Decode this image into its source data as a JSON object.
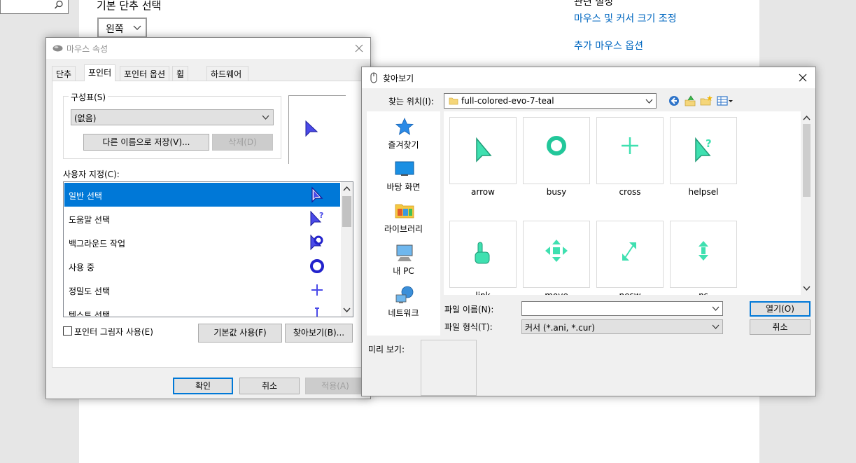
{
  "background": {
    "heading": "기본 단추 선택",
    "button_select_value": "왼쪽",
    "related_heading": "관련 설정",
    "links": [
      "마우스 및 커서 크기 조정",
      "추가 마우스 옵션"
    ]
  },
  "mouse_props": {
    "title": "마우스 속성",
    "tabs": [
      "단추",
      "포인터",
      "포인터 옵션",
      "휠",
      "하드웨어"
    ],
    "active_tab": "포인터",
    "scheme_label": "구성표(S)",
    "scheme_value": "(없음)",
    "save_as_label": "다른 이름으로 저장(V)...",
    "delete_label": "삭제(D)",
    "custom_label": "사용자 지정(C):",
    "cursor_items": [
      "일반 선택",
      "도움말 선택",
      "백그라운드 작업",
      "사용 중",
      "정밀도 선택",
      "텍스트 선택"
    ],
    "selected_index": 0,
    "shadow_label": "포인터 그림자 사용(E)",
    "default_label": "기본값 사용(F)",
    "browse_label": "찾아보기(B)...",
    "ok_label": "확인",
    "cancel_label": "취소",
    "apply_label": "적용(A)"
  },
  "browse": {
    "title": "찾아보기",
    "lookin_label": "찾는 위치(I):",
    "lookin_value": "full-colored-evo-7-teal",
    "places": [
      "즐겨찾기",
      "바탕 화면",
      "라이브러리",
      "내 PC",
      "네트워크"
    ],
    "files": [
      "arrow",
      "busy",
      "cross",
      "helpsel",
      "link",
      "move",
      "nesw",
      "ns"
    ],
    "filename_label": "파일 이름(N):",
    "filename_value": "",
    "filetype_label": "파일 형식(T):",
    "filetype_value": "커서 (*.ani, *.cur)",
    "open_label": "열기(O)",
    "cancel_label": "취소",
    "preview_label": "미리 보기:"
  },
  "colors": {
    "accent": "#0078d7",
    "teal": "#3fe0b0",
    "cursor_blue": "#4a4ae8"
  }
}
